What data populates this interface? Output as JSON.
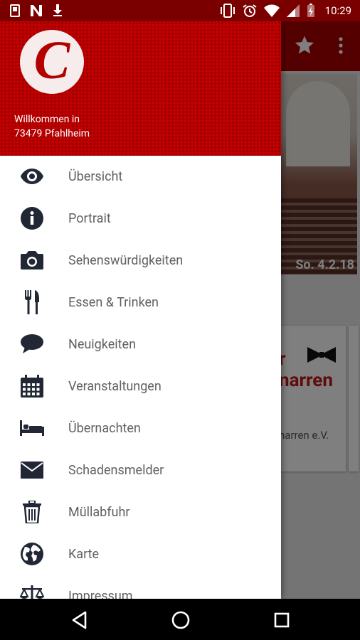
{
  "status_bar": {
    "time": "10:29"
  },
  "header": {
    "welcome_line1": "Willkommen in",
    "welcome_line2": "73479 Pfahlheim",
    "logo_letter": "C"
  },
  "menu": {
    "items": [
      {
        "label": "Übersicht",
        "icon": "eye-icon"
      },
      {
        "label": "Portrait",
        "icon": "info-icon"
      },
      {
        "label": "Sehenswürdigkeiten",
        "icon": "camera-icon"
      },
      {
        "label": "Essen & Trinken",
        "icon": "cutlery-icon"
      },
      {
        "label": "Neuigkeiten",
        "icon": "speech-bubble-icon"
      },
      {
        "label": "Veranstaltungen",
        "icon": "calendar-icon"
      },
      {
        "label": "Übernachten",
        "icon": "bed-icon"
      },
      {
        "label": "Schadensmelder",
        "icon": "envelope-icon"
      },
      {
        "label": "Müllabfuhr",
        "icon": "trash-icon"
      },
      {
        "label": "Karte",
        "icon": "globe-icon"
      },
      {
        "label": "Impressum",
        "icon": "scales-icon"
      }
    ]
  },
  "background": {
    "hero_date": "So. 4.2.18",
    "card_title_line1": "r",
    "card_title_line2": "narren",
    "card_subtitle": "narren e.V."
  },
  "colors": {
    "primary": "#c00000",
    "dark_primary": "#7a0000",
    "icon": "#222736",
    "text": "#616161"
  }
}
